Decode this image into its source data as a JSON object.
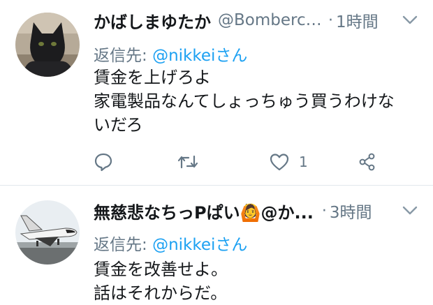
{
  "tweets": [
    {
      "display_name": "かばしまゆたか",
      "handle": "@Bomberca...",
      "separator": "·",
      "time": "1時間",
      "reply_label": "返信先: ",
      "reply_to": "@nikkeiさん",
      "lines": [
        "賃金を上げろよ",
        "家電製品なんてしょっちゅう買うわけな",
        "いだろ"
      ],
      "like_count": "1",
      "avatar": "black-cat-avatar"
    },
    {
      "display_name": "無慈悲なちっPぱい🙆@か...",
      "separator": "·",
      "time": "3時間",
      "reply_label": "返信先: ",
      "reply_to": "@nikkeiさん",
      "lines": [
        "賃金を改善せよ。",
        "話はそれからだ。"
      ],
      "avatar": "space-shuttle-avatar"
    }
  ],
  "colors": {
    "text": "#14171a",
    "secondary": "#657786",
    "link": "#1da1f2",
    "divider": "#e1e8ed"
  },
  "icons": [
    "reply-icon",
    "retweet-icon",
    "like-icon",
    "share-icon",
    "chevron-down-icon"
  ]
}
